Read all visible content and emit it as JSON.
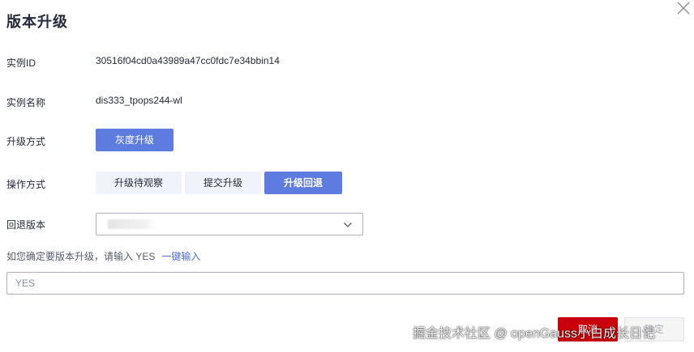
{
  "dialog": {
    "title": "版本升级",
    "close_icon": "close-icon"
  },
  "fields": {
    "instance_id_label": "实例ID",
    "instance_id_value": "30516f04cd0a43989a47cc0fdc7e34bbin14",
    "instance_name_label": "实例名称",
    "instance_name_value": "dis333_tpops244-wl",
    "upgrade_mode_label": "升级方式",
    "upgrade_mode_value": "灰度升级",
    "operation_label": "操作方式",
    "operation_options": [
      "升级待观察",
      "提交升级",
      "升级回退"
    ],
    "operation_selected": "升级回退",
    "rollback_label": "回退版本",
    "rollback_selected": ""
  },
  "confirm": {
    "prompt": "如您确定要版本升级，请输入 YES",
    "one_click_link": "一键输入",
    "input_placeholder": "YES",
    "input_value": ""
  },
  "footer": {
    "cancel_label": "取消",
    "ok_label": "确定"
  },
  "watermark": "掘金技术社区 @ openGauss小白成长日记",
  "colors": {
    "primary": "#5e7ce0",
    "segment_inactive_bg": "#f0f3fc",
    "link": "#526ecc",
    "cancel_bg": "#c7000b",
    "disabled_bg": "#f5f5f6"
  }
}
